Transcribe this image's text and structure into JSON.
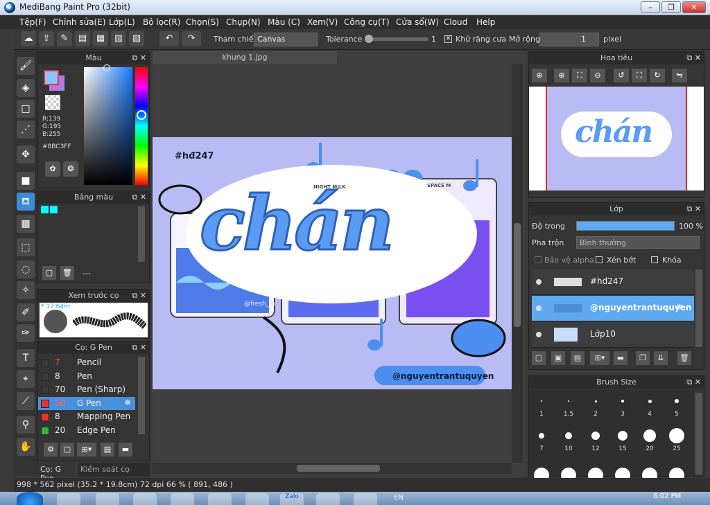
{
  "window": {
    "title": "MediBang Paint Pro (32bit)",
    "min": "–",
    "max": "❐",
    "close": "✕"
  },
  "menu": [
    "Tệp(F)",
    "Chỉnh sửa(E)",
    "Lớp(L)",
    "Bộ lọc(R)",
    "Chọn(S)",
    "Chụp(N)",
    "Màu (C)",
    "Xem(V)",
    "Công cụ(T)",
    "Cửa sổ(W)",
    "Cloud",
    "Help"
  ],
  "toolbar": {
    "ref_label": "Tham chiếu",
    "ref_value": "Canvas",
    "tolerance_label": "Tolerance",
    "tolerance_value": "1",
    "antialias_label": "Khử răng cưa",
    "expand_label": "Mở rộng",
    "expand_value": "1",
    "unit": "pixel"
  },
  "color_panel": {
    "title": "Màu",
    "r": "R:139",
    "g": "G:195",
    "b": "B:255",
    "hex": "#8BC3FF"
  },
  "palette_panel": {
    "title": "Bảng màu",
    "dash": "---"
  },
  "brush_preview": {
    "title": "Xem trước cọ",
    "size": "* 17.64m"
  },
  "brush_panel": {
    "title": "Cọ: G Pen",
    "items": [
      {
        "size": "7",
        "name": "Pencil",
        "color": "#3a3a3a",
        "sizecolor": "#e44"
      },
      {
        "size": "8",
        "name": "Pen",
        "color": "#3a3a3a",
        "sizecolor": "#eee"
      },
      {
        "size": "70",
        "name": "Pen (Sharp)",
        "color": "#3a3a3a",
        "sizecolor": "#eee"
      },
      {
        "size": "50",
        "name": "G Pen",
        "color": "#e33",
        "sizecolor": "#f66"
      },
      {
        "size": "8",
        "name": "Mapping Pen",
        "color": "#e33",
        "sizecolor": "#eee"
      },
      {
        "size": "20",
        "name": "Edge Pen",
        "color": "#3b3",
        "sizecolor": "#eee"
      }
    ],
    "tab1": "Cọ: G Pen",
    "tab2": "Kiểm soát cọ"
  },
  "canvas": {
    "tab": "khung 1.jpg",
    "hashtag": "#hđ247",
    "word": "chán",
    "credit": "@nguyentrantuquyen",
    "carton1": "NIGHT MILK",
    "carton2": "SPACE M",
    "watermark": "@fresh_m"
  },
  "navigator": {
    "title": "Hoa tiêu"
  },
  "layer_panel": {
    "title": "Lớp",
    "opacity_label": "Độ trong",
    "opacity_value": "100 %",
    "opacity": 1.0,
    "blend_label": "Pha trộn",
    "blend_value": "Bình thường",
    "protect_alpha": "Bảo vệ alpha",
    "clip": "Xén bớt",
    "lock": "Khóa",
    "layers": [
      {
        "name": "#hđ247"
      },
      {
        "name": "@nguyentrantuquyen"
      },
      {
        "name": "Lớp10"
      }
    ]
  },
  "brush_size_panel": {
    "title": "Brush Size",
    "sizes": [
      "1",
      "1.5",
      "2",
      "3",
      "4",
      "5",
      "7",
      "10",
      "12",
      "15",
      "20",
      "25"
    ]
  },
  "status": {
    "text": "998 * 562 pixel  (35.2 * 19.8cm)  72 dpi  66 %  ( 891, 486 )"
  },
  "taskbar": {
    "lang": "EN",
    "time": "6:02 PM",
    "zalo": "Zalo"
  }
}
